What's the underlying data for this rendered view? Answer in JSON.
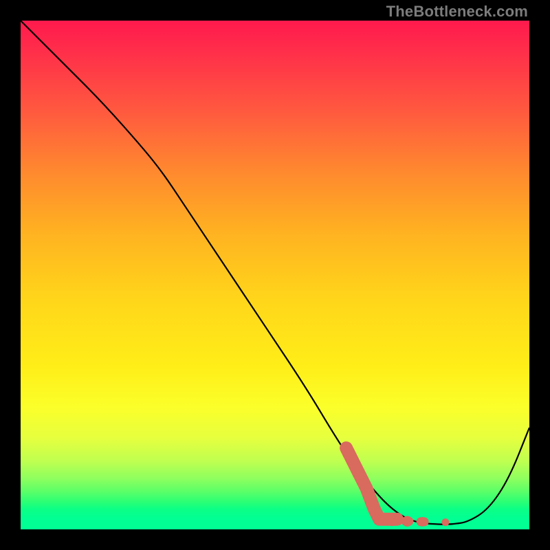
{
  "watermark": "TheBottleneck.com",
  "colors": {
    "frame": "#000000",
    "curve": "#000000",
    "marker": "#d96a5e",
    "gradient_top": "#ff1a4d",
    "gradient_bottom": "#01ff94"
  },
  "chart_data": {
    "type": "line",
    "title": "",
    "xlabel": "",
    "ylabel": "",
    "xlim": [
      0,
      100
    ],
    "ylim": [
      0,
      100
    ],
    "note": "Axes have no visible tick labels; values are expressed as percent of plot width/height. Higher y = higher on screen (closer to top).",
    "series": [
      {
        "name": "bottleneck-curve",
        "x": [
          0,
          8,
          16,
          24,
          28,
          32,
          40,
          48,
          56,
          62,
          66,
          70,
          73,
          76,
          79,
          82,
          85,
          88,
          92,
          96,
          100
        ],
        "y": [
          100,
          92,
          84,
          75,
          70,
          64,
          52,
          40,
          28,
          18,
          12,
          7,
          4,
          2,
          1.2,
          1.0,
          1.0,
          1.5,
          4,
          10,
          20
        ]
      }
    ],
    "markers": {
      "name": "highlighted-region",
      "description": "Salmon dots/stroke near minimum of the curve",
      "points": [
        {
          "x": 64,
          "y": 16
        },
        {
          "x": 66,
          "y": 12
        },
        {
          "x": 68,
          "y": 8
        },
        {
          "x": 69.5,
          "y": 4
        },
        {
          "x": 70.5,
          "y": 2
        },
        {
          "x": 73,
          "y": 1.8
        },
        {
          "x": 76,
          "y": 1.6
        },
        {
          "x": 79,
          "y": 1.5
        },
        {
          "x": 83.5,
          "y": 1.4
        }
      ]
    }
  }
}
